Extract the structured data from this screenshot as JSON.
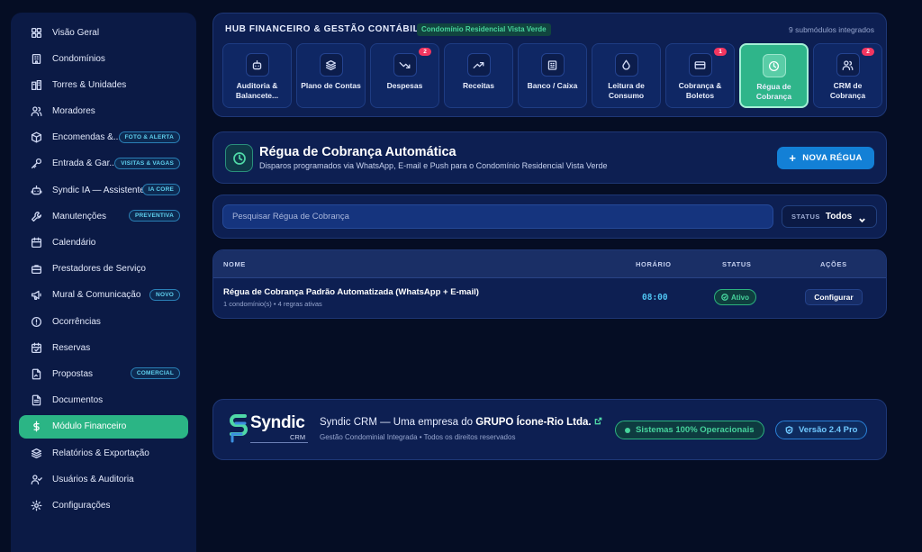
{
  "sidebar": {
    "items": [
      {
        "label": "Visão Geral",
        "icon": "grid-icon"
      },
      {
        "label": "Condomínios",
        "icon": "building-icon"
      },
      {
        "label": "Torres & Unidades",
        "icon": "towers-icon"
      },
      {
        "label": "Moradores",
        "icon": "users-icon"
      },
      {
        "label": "Encomendas &...",
        "icon": "package-icon",
        "pill": "FOTO & ALERTA"
      },
      {
        "label": "Entrada & Gar...",
        "icon": "key-icon",
        "pill": "VISITAS & VAGAS"
      },
      {
        "label": "Syndic IA — Assistente",
        "icon": "bot-icon",
        "pill": "IA CORE"
      },
      {
        "label": "Manutenções",
        "icon": "wrench-icon",
        "pill": "PREVENTIVA"
      },
      {
        "label": "Calendário",
        "icon": "calendar-icon"
      },
      {
        "label": "Prestadores de Serviço",
        "icon": "briefcase-icon"
      },
      {
        "label": "Mural & Comunicação",
        "icon": "megaphone-icon",
        "pill": "NOVO"
      },
      {
        "label": "Ocorrências",
        "icon": "alert-circle-icon"
      },
      {
        "label": "Reservas",
        "icon": "calendar-check-icon"
      },
      {
        "label": "Propostas",
        "icon": "file-signature-icon",
        "pill": "COMERCIAL"
      },
      {
        "label": "Documentos",
        "icon": "file-text-icon"
      },
      {
        "label": "Módulo Financeiro",
        "icon": "dollar-icon",
        "active": true
      },
      {
        "label": "Relatórios & Exportação",
        "icon": "layers-icon"
      },
      {
        "label": "Usuários & Auditoria",
        "icon": "user-check-icon"
      },
      {
        "label": "Configurações",
        "icon": "gear-icon"
      }
    ]
  },
  "hub": {
    "title": "HUB FINANCEIRO & GESTÃO CONTÁBIL",
    "chip": "Condomínio Residencial Vista Verde",
    "count": "9 submódulos integrados",
    "tiles": [
      {
        "label": "Auditoria & Balancete...",
        "icon": "audit-icon",
        "badge": ""
      },
      {
        "label": "Plano de Contas",
        "icon": "layers-icon",
        "badge": ""
      },
      {
        "label": "Despesas",
        "icon": "trending-down-icon",
        "badge": "2"
      },
      {
        "label": "Receitas",
        "icon": "trending-up-icon",
        "badge": ""
      },
      {
        "label": "Banco / Caixa",
        "icon": "bank-icon",
        "badge": ""
      },
      {
        "label": "Leitura de Consumo",
        "icon": "droplet-icon",
        "badge": ""
      },
      {
        "label": "Cobrança & Boletos",
        "icon": "credit-card-icon",
        "badge": "1"
      },
      {
        "label": "Régua de Cobrança",
        "icon": "clock-icon",
        "badge": "",
        "active": true
      },
      {
        "label": "CRM de Cobrança",
        "icon": "users-icon",
        "badge": "2"
      }
    ]
  },
  "header": {
    "icon": "clock-icon",
    "title": "Régua de Cobrança Automática",
    "subtitle": "Disparos programados via WhatsApp, E-mail e Push para o Condomínio Residencial Vista Verde",
    "new_button": "NOVA RÉGUA"
  },
  "search": {
    "placeholder": "Pesquisar Régua de Cobrança",
    "value": "",
    "status_label": "STATUS",
    "status_value": "Todos"
  },
  "table": {
    "columns": [
      "NOME",
      "HORÁRIO",
      "STATUS",
      "AÇÕES"
    ],
    "rows": [
      {
        "name": "Régua de Cobrança Padrão Automatizada (WhatsApp + E-mail)",
        "meta": "1 condomínio(s) • 4 regras ativas",
        "time": "08:00",
        "status": "Ativo",
        "action": "Configurar"
      }
    ]
  },
  "footer": {
    "logo_word": "Syndic",
    "logo_crm": "CRM",
    "title_prefix": "Syndic CRM — Uma empresa do ",
    "title_company": "GRUPO Ícone-Rio Ltda.",
    "subtitle": "Gestão Condominial Integrada • Todos os direitos reservados",
    "ops_status": "Sistemas 100% Operacionais",
    "version": "Versão 2.4 Pro"
  },
  "colors": {
    "background": "#050d24",
    "panel": "#0d1f52",
    "accent_green": "#2bb585",
    "accent_blue": "#1380d6",
    "badge_red": "#f23660"
  }
}
